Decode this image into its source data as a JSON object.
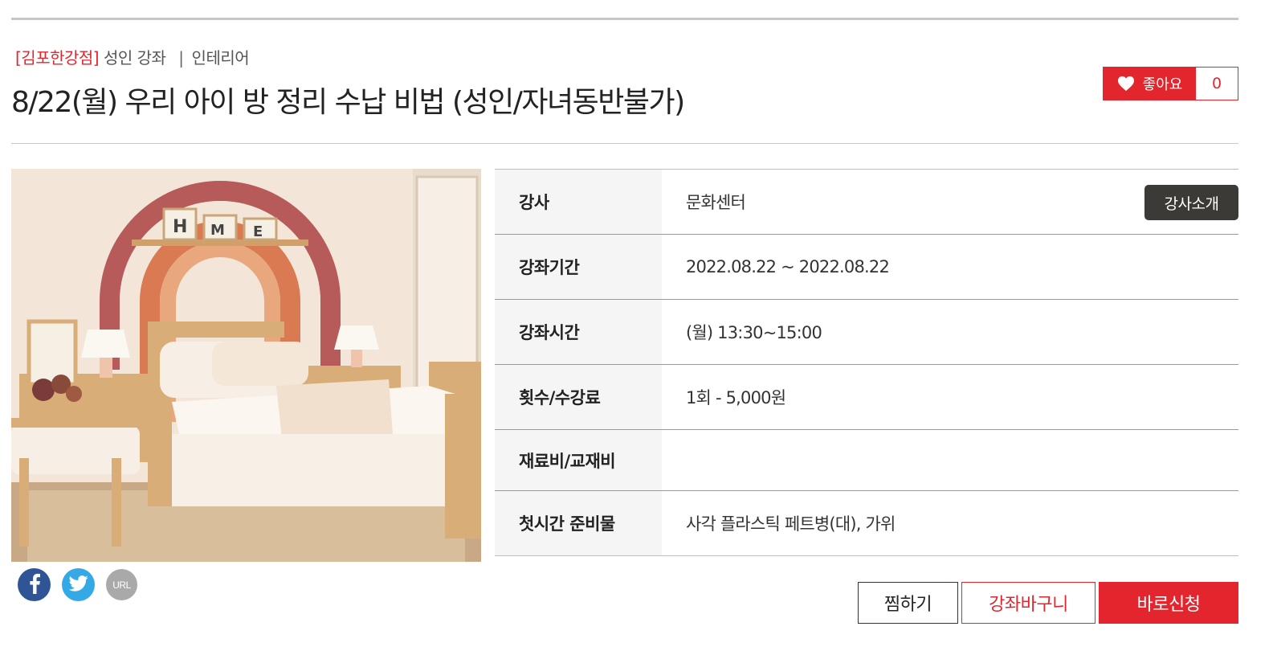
{
  "breadcrumb": {
    "branch": "[김포한강점]",
    "category": "성인 강좌",
    "separator": "|",
    "subcategory": "인테리어"
  },
  "title": "8/22(월) 우리 아이 방 정리 수납 비법 (성인/자녀동반불가)",
  "like": {
    "label": "좋아요",
    "count": "0"
  },
  "image": {
    "wall_letters": [
      "H",
      "M",
      "E"
    ]
  },
  "info": {
    "instructor_label": "강사",
    "instructor_value": "문화센터",
    "instructor_button": "강사소개",
    "period_label": "강좌기간",
    "period_value": "2022.08.22 ~ 2022.08.22",
    "time_label": "강좌시간",
    "time_value": "(월) 13:30~15:00",
    "fee_label": "횟수/수강료",
    "fee_value": "1회 - 5,000원",
    "materials_label": "재료비/교재비",
    "materials_value": "",
    "prep_label": "첫시간 준비물",
    "prep_value": "사각 플라스틱 페트병(대), 가위"
  },
  "share": {
    "url_label": "URL"
  },
  "actions": {
    "wish": "찜하기",
    "cart": "강좌바구니",
    "apply": "바로신청"
  },
  "colors": {
    "accent": "#e3262e",
    "dark_button": "#3c3a36",
    "facebook": "#2f5597",
    "twitter": "#34a9e6"
  }
}
